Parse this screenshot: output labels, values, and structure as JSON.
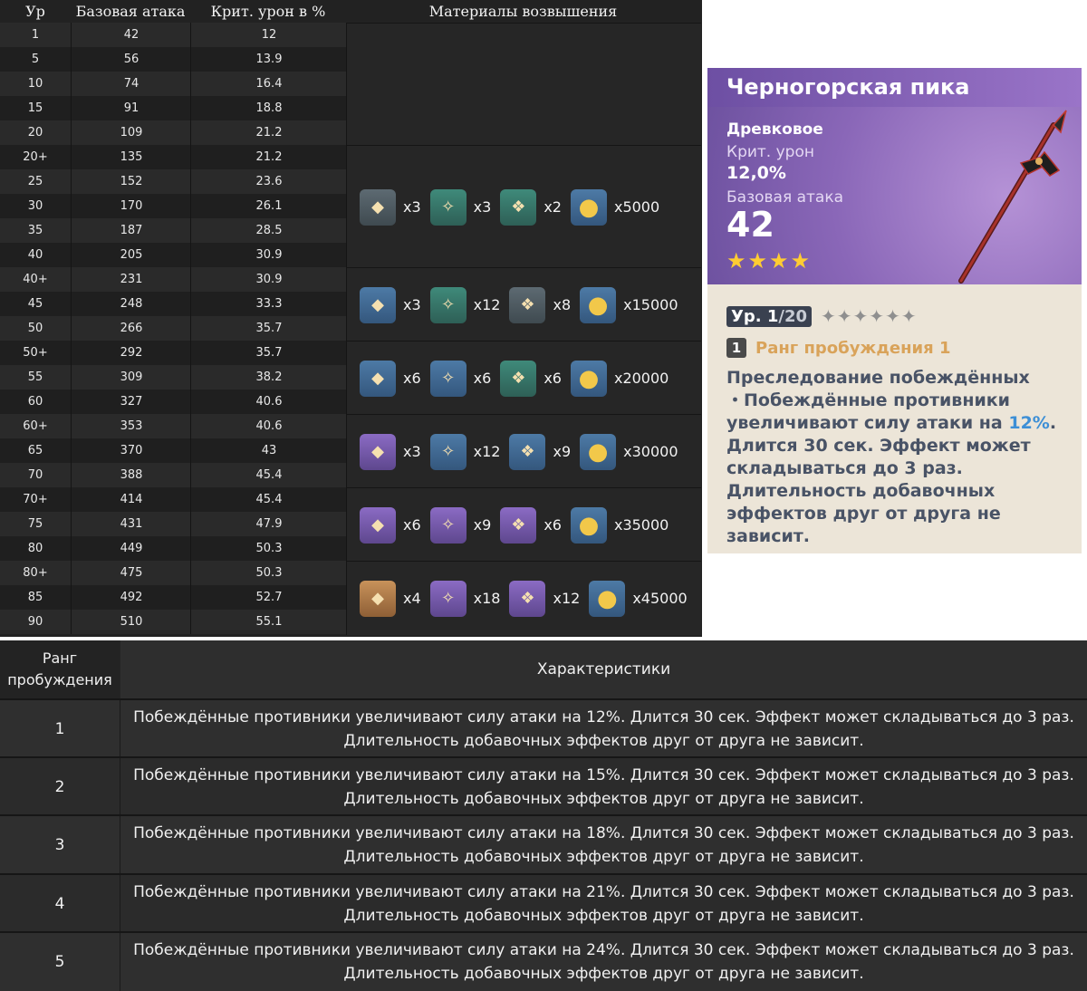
{
  "stats_table": {
    "headers": {
      "level": "Ур",
      "base_atk": "Базовая атака",
      "crit_dmg": "Крит. урон в %",
      "materials": "Материалы возвышения"
    },
    "rows": [
      {
        "lv": "1",
        "atk": "42",
        "crit": "12"
      },
      {
        "lv": "5",
        "atk": "56",
        "crit": "13.9"
      },
      {
        "lv": "10",
        "atk": "74",
        "crit": "16.4"
      },
      {
        "lv": "15",
        "atk": "91",
        "crit": "18.8"
      },
      {
        "lv": "20",
        "atk": "109",
        "crit": "21.2"
      },
      {
        "lv": "20+",
        "atk": "135",
        "crit": "21.2"
      },
      {
        "lv": "25",
        "atk": "152",
        "crit": "23.6"
      },
      {
        "lv": "30",
        "atk": "170",
        "crit": "26.1"
      },
      {
        "lv": "35",
        "atk": "187",
        "crit": "28.5"
      },
      {
        "lv": "40",
        "atk": "205",
        "crit": "30.9"
      },
      {
        "lv": "40+",
        "atk": "231",
        "crit": "30.9"
      },
      {
        "lv": "45",
        "atk": "248",
        "crit": "33.3"
      },
      {
        "lv": "50",
        "atk": "266",
        "crit": "35.7"
      },
      {
        "lv": "50+",
        "atk": "292",
        "crit": "35.7"
      },
      {
        "lv": "55",
        "atk": "309",
        "crit": "38.2"
      },
      {
        "lv": "60",
        "atk": "327",
        "crit": "40.6"
      },
      {
        "lv": "60+",
        "atk": "353",
        "crit": "40.6"
      },
      {
        "lv": "65",
        "atk": "370",
        "crit": "43"
      },
      {
        "lv": "70",
        "atk": "388",
        "crit": "45.4"
      },
      {
        "lv": "70+",
        "atk": "414",
        "crit": "45.4"
      },
      {
        "lv": "75",
        "atk": "431",
        "crit": "47.9"
      },
      {
        "lv": "80",
        "atk": "449",
        "crit": "50.3"
      },
      {
        "lv": "80+",
        "atk": "475",
        "crit": "50.3"
      },
      {
        "lv": "85",
        "atk": "492",
        "crit": "52.7"
      },
      {
        "lv": "90",
        "atk": "510",
        "crit": "55.1"
      }
    ],
    "material_groups": [
      [
        {
          "icon": "weapon-domain-material-icon",
          "rarity": "gray",
          "qty": "x3"
        },
        {
          "icon": "common-material-icon",
          "rarity": "green",
          "qty": "x3"
        },
        {
          "icon": "elite-material-icon",
          "rarity": "green",
          "qty": "x2"
        },
        {
          "icon": "mora-coin-icon",
          "rarity": "blue",
          "qty": "x5000"
        }
      ],
      [
        {
          "icon": "weapon-domain-material-icon",
          "rarity": "blue",
          "qty": "x3"
        },
        {
          "icon": "common-material-icon",
          "rarity": "green",
          "qty": "x12"
        },
        {
          "icon": "elite-material-icon",
          "rarity": "gray",
          "qty": "x8"
        },
        {
          "icon": "mora-coin-icon",
          "rarity": "blue",
          "qty": "x15000"
        }
      ],
      [
        {
          "icon": "weapon-domain-material-icon",
          "rarity": "blue",
          "qty": "x6"
        },
        {
          "icon": "common-material-icon",
          "rarity": "blue",
          "qty": "x6"
        },
        {
          "icon": "elite-material-icon",
          "rarity": "green",
          "qty": "x6"
        },
        {
          "icon": "mora-coin-icon",
          "rarity": "blue",
          "qty": "x20000"
        }
      ],
      [
        {
          "icon": "weapon-domain-material-icon",
          "rarity": "purple",
          "qty": "x3"
        },
        {
          "icon": "common-material-icon",
          "rarity": "blue",
          "qty": "x12"
        },
        {
          "icon": "elite-material-icon",
          "rarity": "blue",
          "qty": "x9"
        },
        {
          "icon": "mora-coin-icon",
          "rarity": "blue",
          "qty": "x30000"
        }
      ],
      [
        {
          "icon": "weapon-domain-material-icon",
          "rarity": "purple",
          "qty": "x6"
        },
        {
          "icon": "common-material-icon",
          "rarity": "purple",
          "qty": "x9"
        },
        {
          "icon": "elite-material-icon",
          "rarity": "purple",
          "qty": "x6"
        },
        {
          "icon": "mora-coin-icon",
          "rarity": "blue",
          "qty": "x35000"
        }
      ],
      [
        {
          "icon": "weapon-domain-material-icon",
          "rarity": "gold",
          "qty": "x4"
        },
        {
          "icon": "common-material-icon",
          "rarity": "purple",
          "qty": "x18"
        },
        {
          "icon": "elite-material-icon",
          "rarity": "purple",
          "qty": "x12"
        },
        {
          "icon": "mora-coin-icon",
          "rarity": "blue",
          "qty": "x45000"
        }
      ]
    ]
  },
  "weapon_card": {
    "name": "Черногорская пика",
    "type": "Древковое",
    "substat_label": "Крит. урон",
    "substat_value": "12,0%",
    "base_atk_label": "Базовая атака",
    "base_atk_value": "42",
    "stars": "★★★★",
    "level_prefix": "Ур. 1",
    "level_max": "/20",
    "refine_stars": "✦✦✦✦✦✦",
    "refine_rank_num": "1",
    "refine_rank_label": "Ранг пробуждения 1",
    "passive_line1": "Преследование побеждённых",
    "passive_line2": "・Побеждённые противники",
    "passive_line3_pre": "увеличивают силу атаки на ",
    "passive_line3_hl": "12%",
    "passive_line3_post": ".",
    "passive_line4": "Длится 30 сек. Эффект может",
    "passive_line5": "складываться до 3 раз.",
    "passive_line6": "Длительность добавочных",
    "passive_line7": "эффектов друг от друга не",
    "passive_line8": "зависит.",
    "colors": {
      "header": "#7a5aaf",
      "stars": "#ffcc33",
      "highlight": "#3d8fd6",
      "rank_label": "#d9a35a"
    }
  },
  "refine_table": {
    "header_rank_line1": "Ранг",
    "header_rank_line2": "пробуждения",
    "header_desc": "Характеристики",
    "rows": [
      {
        "rank": "1",
        "line1": "Побеждённые противники увеличивают силу атаки на 12%. Длится 30 сек. Эффект может складываться до 3 раз.",
        "line2": "Длительность добавочных эффектов друг от друга не зависит."
      },
      {
        "rank": "2",
        "line1": "Побеждённые противники увеличивают силу атаки на 15%. Длится 30 сек. Эффект может складываться до 3 раз.",
        "line2": "Длительность добавочных эффектов друг от друга не зависит."
      },
      {
        "rank": "3",
        "line1": "Побеждённые противники увеличивают силу атаки на 18%. Длится 30 сек. Эффект может складываться до 3 раз.",
        "line2": "Длительность добавочных эффектов друг от друга не зависит."
      },
      {
        "rank": "4",
        "line1": "Побеждённые противники увеличивают силу атаки на 21%. Длится 30 сек. Эффект может складываться до 3 раз.",
        "line2": "Длительность добавочных эффектов друг от друга не зависит."
      },
      {
        "rank": "5",
        "line1": "Побеждённые противники увеличивают силу атаки на 24%. Длится 30 сек. Эффект может складываться до 3 раз.",
        "line2": "Длительность добавочных эффектов друг от друга не зависит."
      }
    ]
  }
}
